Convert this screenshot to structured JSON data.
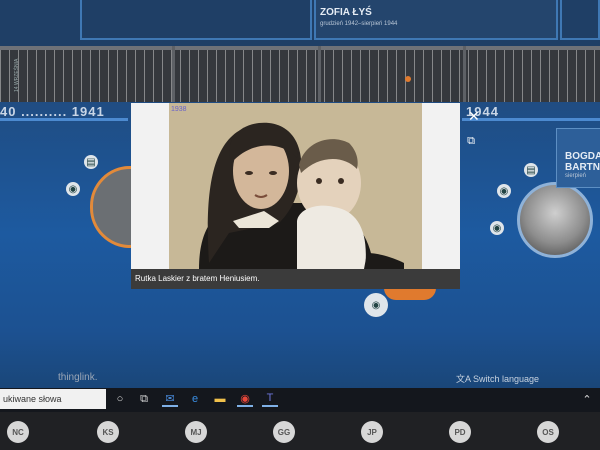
{
  "top_card": {
    "name": "ZOFIA ŁYŚ",
    "dates": "grudzień 1942–sierpień 1944"
  },
  "right_card": {
    "name": "BOGDA\nBARTN",
    "dates": "sierpień"
  },
  "vertical_label": "14 WRZEŚNIA",
  "years": {
    "left": "40 .......... 1941",
    "right": "1944"
  },
  "photo_modal": {
    "stamp": "1938",
    "caption": "Rutka Laskier z bratem Heniusiem."
  },
  "thinglink": "thinglink.",
  "switch_language": "Switch language",
  "taskbar": {
    "search_text": "ukiwane słowa"
  },
  "participants": [
    "NC",
    "KS",
    "MJ",
    "GG",
    "JP",
    "PD",
    "OS"
  ],
  "colors": {
    "accent_blue": "#1d5aa0",
    "orange": "#e07a2e"
  }
}
